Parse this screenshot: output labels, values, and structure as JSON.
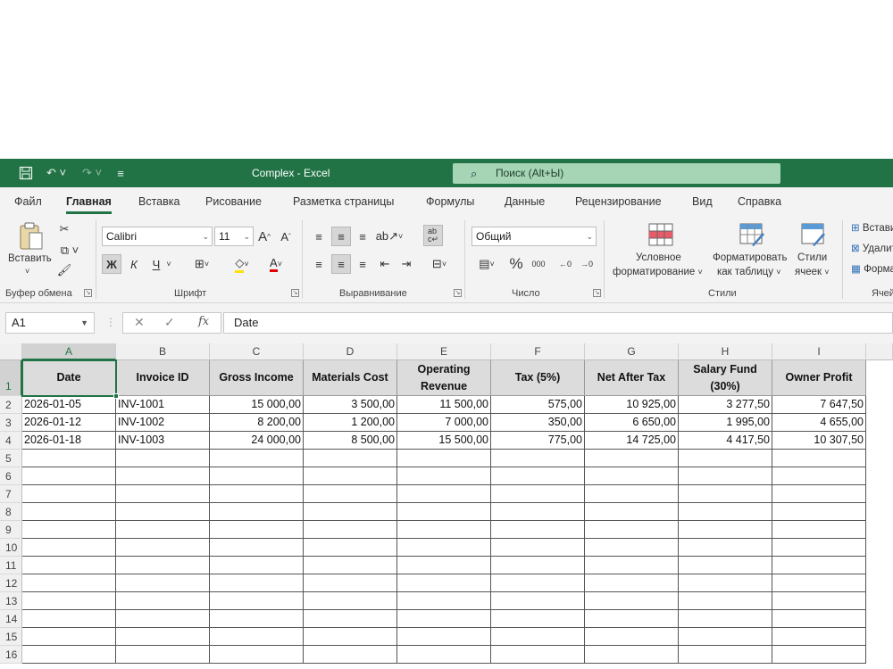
{
  "titlebar": {
    "title": "Complex  -  Excel",
    "search_placeholder": "Поиск (Alt+Ы)",
    "save_icon": "save-icon",
    "undo_icon": "undo-icon",
    "redo_icon": "redo-icon"
  },
  "menu": {
    "tabs": [
      "Файл",
      "Главная",
      "Вставка",
      "Рисование",
      "Разметка страницы",
      "Формулы",
      "Данные",
      "Рецензирование",
      "Вид",
      "Справка"
    ],
    "active": "Главная"
  },
  "ribbon": {
    "clipboard": {
      "paste_label": "Вставить",
      "group_label": "Буфер обмена"
    },
    "font": {
      "font_name": "Calibri",
      "font_size": "11",
      "bold": "Ж",
      "italic": "К",
      "underline": "Ч",
      "group_label": "Шрифт"
    },
    "alignment": {
      "group_label": "Выравнивание"
    },
    "number": {
      "format": "Общий",
      "group_label": "Число",
      "percent": "%",
      "thousands": "000"
    },
    "styles": {
      "conditional_line1": "Условное",
      "conditional_line2": "форматирование",
      "table_line1": "Форматировать",
      "table_line2": "как таблицу",
      "cell_line1": "Стили",
      "cell_line2": "ячеек",
      "group_label": "Стили"
    },
    "cells": {
      "insert": "Вставить",
      "delete": "Удалить",
      "format": "Формат",
      "group_label": "Ячейки"
    }
  },
  "formula_bar": {
    "name_box": "A1",
    "fx": "fx",
    "value": "Date"
  },
  "sheet": {
    "columns": [
      "A",
      "B",
      "C",
      "D",
      "E",
      "F",
      "G",
      "H",
      "I"
    ],
    "rows": [
      "1",
      "2",
      "3",
      "4",
      "5",
      "6",
      "7",
      "8",
      "9",
      "10",
      "11",
      "12",
      "13",
      "14",
      "15",
      "16"
    ],
    "headers": [
      "Date",
      "Invoice ID",
      "Gross Income",
      "Materials Cost",
      "Operating Revenue",
      "Tax (5%)",
      "Net After Tax",
      "Salary Fund (30%)",
      "Owner Profit"
    ],
    "data": [
      [
        "2026-01-05",
        "INV-1001",
        "15 000,00",
        "3 500,00",
        "11 500,00",
        "575,00",
        "10 925,00",
        "3 277,50",
        "7 647,50"
      ],
      [
        "2026-01-12",
        "INV-1002",
        "8 200,00",
        "1 200,00",
        "7 000,00",
        "350,00",
        "6 650,00",
        "1 995,00",
        "4 655,00"
      ],
      [
        "2026-01-18",
        "INV-1003",
        "24 000,00",
        "8 500,00",
        "15 500,00",
        "775,00",
        "14 725,00",
        "4 417,50",
        "10 307,50"
      ]
    ]
  }
}
